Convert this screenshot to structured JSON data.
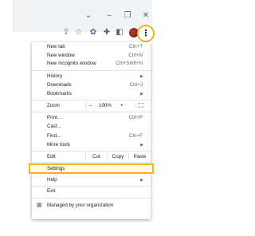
{
  "titlebar": {
    "collapse_icon": "chevron-down-icon",
    "minimize_icon": "minimize-icon",
    "restore_icon": "restore-icon",
    "close_icon": "close-icon"
  },
  "toolbar": {
    "share_icon": "share-icon",
    "star_icon": "star-icon",
    "extensions_icon": "puzzle-icon",
    "sidepanel_icon": "side-panel-icon",
    "menu_icon": "kebab-menu-icon"
  },
  "menu": {
    "items": [
      {
        "label": "New tab",
        "shortcut": "Ctrl+T"
      },
      {
        "label": "New window",
        "shortcut": "Ctrl+N"
      },
      {
        "label": "New Incognito window",
        "shortcut": "Ctrl+Shift+N"
      },
      {
        "label": "History",
        "shortcut": ""
      },
      {
        "label": "Downloads",
        "shortcut": "Ctrl+J"
      },
      {
        "label": "Bookmarks",
        "shortcut": ""
      },
      {
        "label": "Zoom",
        "shortcut": ""
      },
      {
        "label": "Print...",
        "shortcut": "Ctrl+P"
      },
      {
        "label": "Cast...",
        "shortcut": ""
      },
      {
        "label": "Find...",
        "shortcut": "Ctrl+F"
      },
      {
        "label": "More tools",
        "shortcut": ""
      },
      {
        "label": "Edit",
        "shortcut": ""
      },
      {
        "label": "Settings",
        "shortcut": ""
      },
      {
        "label": "Help",
        "shortcut": ""
      },
      {
        "label": "Exit",
        "shortcut": ""
      },
      {
        "label": "Managed by your organization",
        "shortcut": ""
      }
    ],
    "zoom": {
      "minus": "–",
      "value": "100%",
      "plus": "+"
    },
    "edit": {
      "cut": "Cut",
      "copy": "Copy",
      "paste": "Paste"
    }
  },
  "colors": {
    "highlight": "#f6b21b",
    "menu_bg": "#ffffff"
  }
}
